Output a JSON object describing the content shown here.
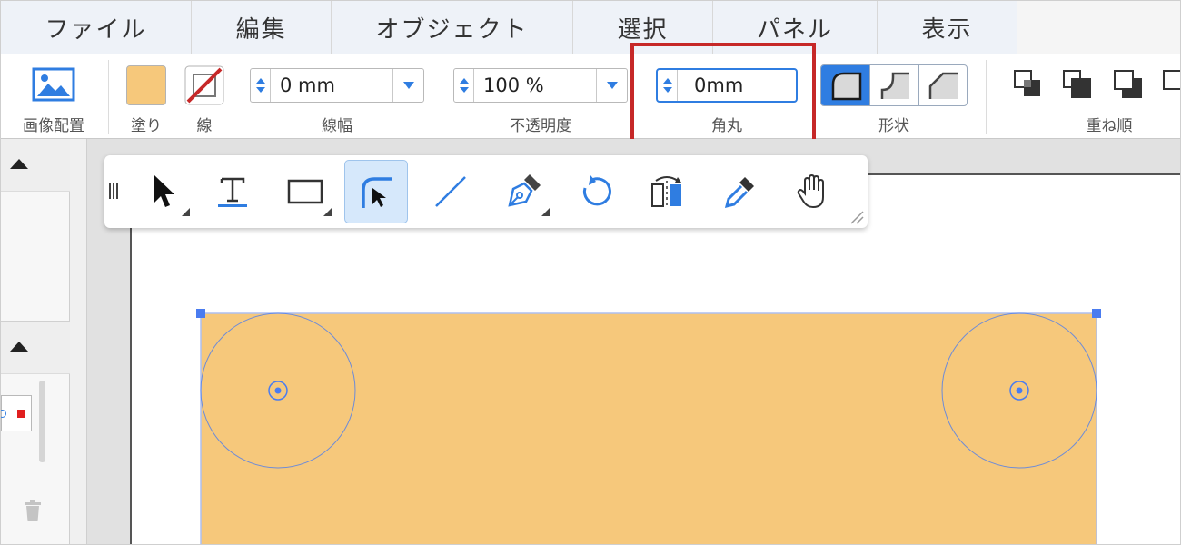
{
  "menu": {
    "items": [
      "ファイル",
      "編集",
      "オブジェクト",
      "選択",
      "パネル",
      "表示"
    ]
  },
  "toolbar": {
    "image_place_label": "画像配置",
    "fill_label": "塗り",
    "stroke_label": "線",
    "stroke_width": {
      "value": "0 mm",
      "label": "線幅"
    },
    "opacity": {
      "value": "100 %",
      "label": "不透明度"
    },
    "corner_radius": {
      "value": "0mm",
      "label": "角丸"
    },
    "shape_label": "形状",
    "order_label": "重ね順",
    "fill_color": "#f6c87b",
    "stroke_color": "#c62828"
  },
  "palette": {
    "tools": [
      "grip-icon",
      "select-arrow-icon",
      "text-tool-icon",
      "rectangle-tool-icon",
      "corner-edit-tool-icon",
      "line-tool-icon",
      "pen-tool-icon",
      "rotate-tool-icon",
      "flip-tool-icon",
      "eyedropper-icon",
      "hand-tool-icon"
    ],
    "active_tool": "corner-edit-tool-icon"
  },
  "canvas": {
    "shape_fill": "#f6c87b",
    "selection_color": "#4a7cf0"
  },
  "colors": {
    "accent": "#2f7de1",
    "highlight": "#c62828"
  }
}
